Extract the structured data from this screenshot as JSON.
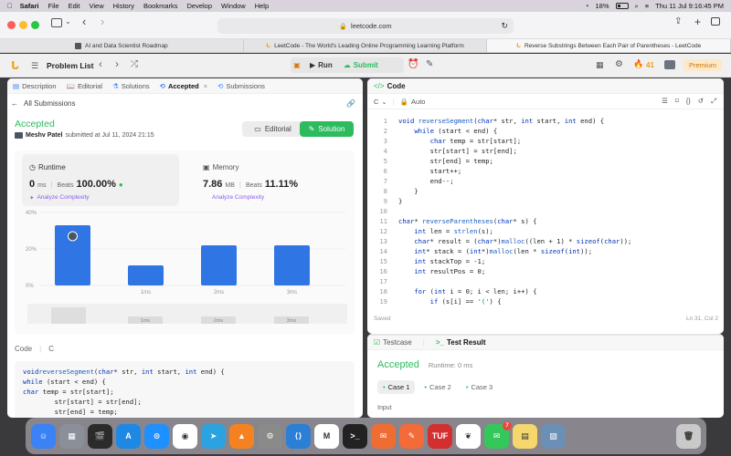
{
  "menubar": {
    "apple": "",
    "app": "Safari",
    "items": [
      "File",
      "Edit",
      "View",
      "History",
      "Bookmarks",
      "Develop",
      "Window",
      "Help"
    ],
    "battery": "18%",
    "clock": "Thu 11 Jul  9:16:45 PM"
  },
  "browser": {
    "url": "leetcode.com",
    "tabs": [
      {
        "label": "AI and Data Scientist Roadmap"
      },
      {
        "label": "LeetCode - The World's Leading Online Programming Learning Platform"
      },
      {
        "label": "Reverse Substrings Between Each Pair of Parentheses - LeetCode"
      }
    ]
  },
  "lc_header": {
    "problem_list": "Problem List",
    "run": "Run",
    "submit": "Submit",
    "streak": "41",
    "premium": "Premium"
  },
  "left_tabs": [
    "Description",
    "Editorial",
    "Solutions",
    "Accepted",
    "Submissions"
  ],
  "submissions_link": "All Submissions",
  "result": {
    "status": "Accepted",
    "user": "Meshv Patel",
    "submitted": "submitted at Jul 11, 2024 21:15",
    "editorial_btn": "Editorial",
    "solution_btn": "Solution"
  },
  "runtime": {
    "label": "Runtime",
    "value": "0",
    "unit": "ms",
    "beats_label": "Beats",
    "beats": "100.00%",
    "analyze": "Analyze Complexity"
  },
  "memory": {
    "label": "Memory",
    "value": "7.86",
    "unit": "MB",
    "beats_label": "Beats",
    "beats": "11.11%",
    "analyze": "Analyze Complexity"
  },
  "chart_data": {
    "type": "bar",
    "y_ticks": [
      "40%",
      "20%",
      "0%"
    ],
    "ylim": [
      0,
      40
    ],
    "x_labels": [
      "",
      "1ms",
      "2ms",
      "3ms"
    ],
    "values": [
      33,
      11,
      22,
      22
    ],
    "minimap_labels": [
      "",
      "1ms",
      "2ms",
      "3ms"
    ],
    "color": "#2f76e4"
  },
  "code_section": {
    "label": "Code",
    "lang": "C",
    "lines": [
      "void reverseSegment(char* str, int start, int end) {",
      "    while (start < end) {",
      "        char temp = str[start];",
      "        str[start] = str[end];",
      "        str[end] = temp;"
    ]
  },
  "editor": {
    "title": "Code",
    "lang": "C",
    "mode": "Auto",
    "saved": "Saved",
    "position": "Ln 31, Col 2",
    "lines": [
      "void reverseSegment(char* str, int start, int end) {",
      "    while (start < end) {",
      "        char temp = str[start];",
      "        str[start] = str[end];",
      "        str[end] = temp;",
      "        start++;",
      "        end--;",
      "    }",
      "}",
      "",
      "char* reverseParentheses(char* s) {",
      "    int len = strlen(s);",
      "    char* result = (char*)malloc((len + 1) * sizeof(char));",
      "    int* stack = (int*)malloc(len * sizeof(int));",
      "    int stackTop = -1;",
      "    int resultPos = 0;",
      "",
      "    for (int i = 0; i < len; i++) {",
      "        if (s[i] == '(') {"
    ],
    "line_numbers": [
      "1",
      "2",
      "3",
      "4",
      "5",
      "6",
      "7",
      "8",
      "9",
      "10",
      "11",
      "12",
      "13",
      "14",
      "15",
      "16",
      "17",
      "18",
      "19"
    ]
  },
  "testpanel": {
    "tab1": "Testcase",
    "tab2": "Test Result",
    "status": "Accepted",
    "runtime": "Runtime: 0 ms",
    "cases": [
      "Case 1",
      "Case 2",
      "Case 3"
    ],
    "input_label": "Input"
  },
  "dock": {
    "apps": [
      "Finder",
      "Launchpad",
      "Final Cut Pro",
      "App Store",
      "Safari",
      "Chrome",
      "Telegram",
      "VLC",
      "System Settings",
      "VS Code",
      "Gmail",
      "Terminal",
      "Postman",
      "Pen",
      "TUF",
      "MongoDB",
      "Messages",
      "Notes",
      "Preview",
      "Trash"
    ],
    "messages_badge": "7"
  }
}
